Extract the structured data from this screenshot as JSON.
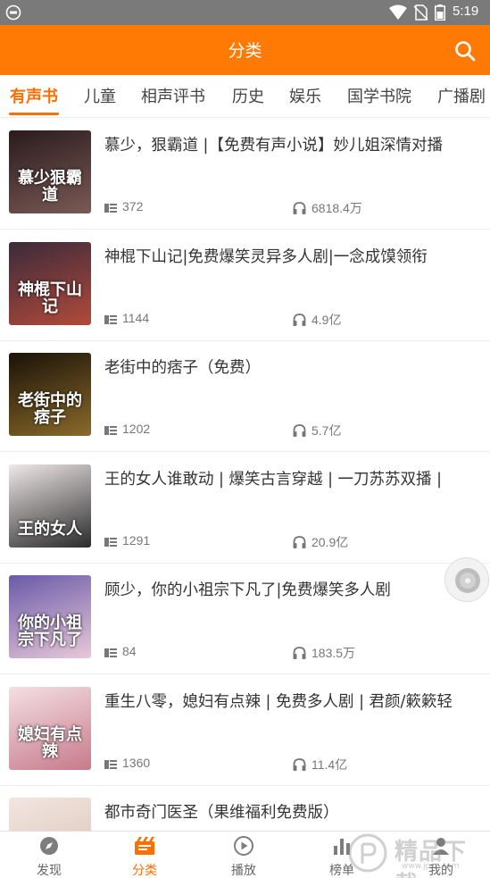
{
  "status_bar": {
    "time": "5:19"
  },
  "header": {
    "title": "分类",
    "search_icon": "search-icon"
  },
  "tabs": [
    {
      "label": "有声书",
      "active": true
    },
    {
      "label": "儿童"
    },
    {
      "label": "相声评书"
    },
    {
      "label": "历史"
    },
    {
      "label": "娱乐"
    },
    {
      "label": "国学书院"
    },
    {
      "label": "广播剧"
    }
  ],
  "items": [
    {
      "title": "慕少，狠霸道 |【免费有声小说】妙儿姐深情对播",
      "count": "372",
      "plays": "6818.4万",
      "cover_text": "慕少狠霸道",
      "cover_colors": [
        "#2a1b1e",
        "#7a5a55"
      ]
    },
    {
      "title": "神棍下山记|免费爆笑灵异多人剧|一念成馍领衔",
      "count": "1144",
      "plays": "4.9亿",
      "cover_text": "神棍下山记",
      "cover_colors": [
        "#3b2a3a",
        "#b24a3a"
      ]
    },
    {
      "title": "老街中的痞子（免费）",
      "count": "1202",
      "plays": "5.7亿",
      "cover_text": "老街中的痞子",
      "cover_colors": [
        "#1a1208",
        "#8a6a2a"
      ]
    },
    {
      "title": "王的女人谁敢动 | 爆笑古言穿越 | 一刀苏苏双播 |",
      "count": "1291",
      "plays": "20.9亿",
      "cover_text": "王的女人",
      "cover_colors": [
        "#efe8e8",
        "#2a2a2a"
      ]
    },
    {
      "title": "顾少，你的小祖宗下凡了|免费爆笑多人剧",
      "count": "84",
      "plays": "183.5万",
      "cover_text": "你的小祖宗下凡了",
      "cover_colors": [
        "#6a5aa8",
        "#e8c8d8"
      ]
    },
    {
      "title": "重生八零，媳妇有点辣 | 免费多人剧 | 君颜/簌簌轻",
      "count": "1360",
      "plays": "11.4亿",
      "cover_text": "媳妇有点辣",
      "cover_colors": [
        "#f4dfe4",
        "#c77a8a"
      ]
    },
    {
      "title": "都市奇门医圣（果维福利免费版）",
      "count": "",
      "plays": "",
      "cover_text": "",
      "cover_colors": [
        "#f2e6e0",
        "#d8c0b4"
      ]
    }
  ],
  "bottom_nav": [
    {
      "label": "发现",
      "icon": "compass-icon"
    },
    {
      "label": "分类",
      "icon": "category-icon",
      "active": true
    },
    {
      "label": "播放",
      "icon": "play-icon"
    },
    {
      "label": "榜单",
      "icon": "chart-icon"
    },
    {
      "label": "我的",
      "icon": "user-icon"
    }
  ],
  "watermark": {
    "text": "精品下载",
    "url": "www.jpxz.com"
  },
  "colors": {
    "accent": "#ff7a05",
    "active_tab": "#ff6e00"
  }
}
